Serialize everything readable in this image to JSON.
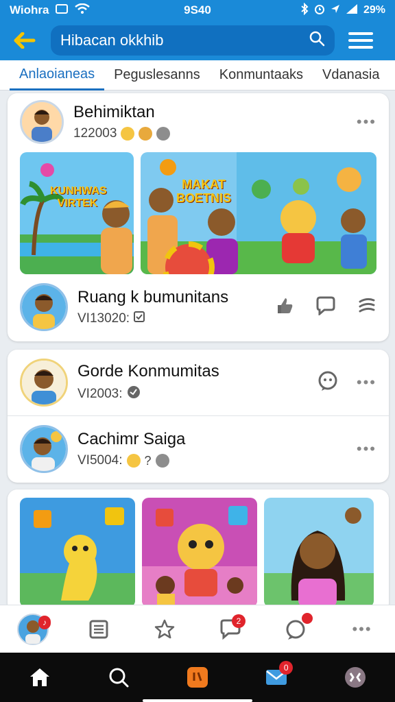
{
  "status": {
    "carrier": "Wiohra",
    "time": "9S40",
    "battery": "29%"
  },
  "header": {
    "search_text": "Hibacan okkhib"
  },
  "tabs": [
    "Anlaoianeas",
    "Peguslesanns",
    "Konmuntaaks",
    "Vdanasia"
  ],
  "post1": {
    "author": "Behimiktan",
    "meta": "122003",
    "thumb1_title": "KUNHWAS VIRTEK",
    "thumb2_title": "MAKAT BOETNIS"
  },
  "post1_footer": {
    "name": "Ruang k bumunitans",
    "meta": "VI13020:"
  },
  "post2": {
    "name": "Gorde Konmumitas",
    "meta": "VI2003:"
  },
  "post3": {
    "name": "Cachimr Saiga",
    "meta": "VI5004:"
  },
  "bottom_nav": {
    "notif_badge": "2",
    "chat_badge": ""
  },
  "system_nav": {
    "mail_badge": "0"
  },
  "colors": {
    "brand": "#1a8ad8",
    "tab_active": "#1a6fc0",
    "badge": "#e0242c"
  }
}
